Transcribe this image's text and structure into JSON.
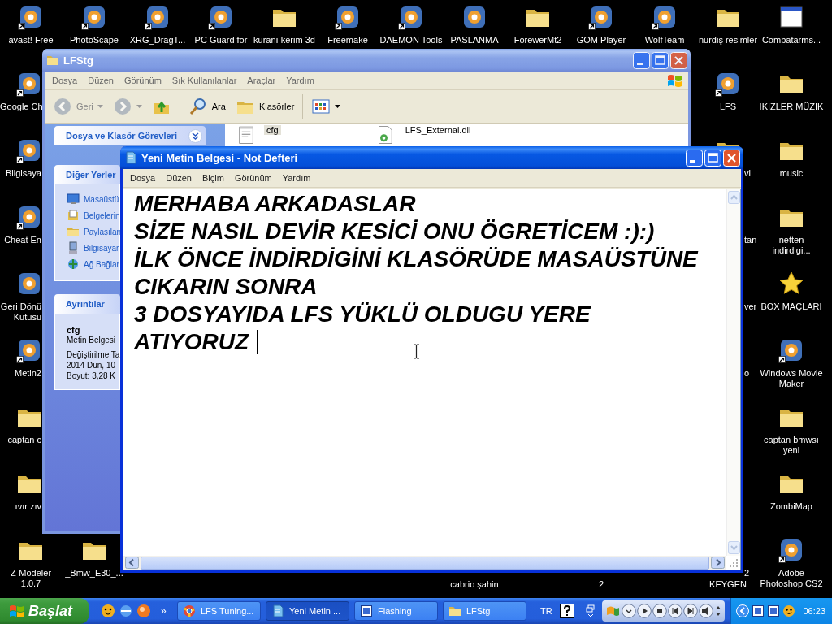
{
  "desktop_icons": [
    {
      "label": [
        "avast! Free"
      ],
      "kind": "app",
      "shortcut": true
    },
    {
      "label": [
        "PhotoScape"
      ],
      "kind": "app",
      "shortcut": true
    },
    {
      "label": [
        "XRG_DragT..."
      ],
      "kind": "app",
      "shortcut": true
    },
    {
      "label": [
        "PC Guard for"
      ],
      "kind": "app",
      "shortcut": true
    },
    {
      "label": [
        "kuranı kerim 3d"
      ],
      "kind": "folder",
      "shortcut": false
    },
    {
      "label": [
        "Freemake"
      ],
      "kind": "app",
      "shortcut": true
    },
    {
      "label": [
        "DAEMON Tools"
      ],
      "kind": "app",
      "shortcut": true
    },
    {
      "label": [
        "PASLANMA"
      ],
      "kind": "app",
      "shortcut": false
    },
    {
      "label": [
        "ForewerMt2"
      ],
      "kind": "folder",
      "shortcut": false
    },
    {
      "label": [
        "GOM Player"
      ],
      "kind": "app",
      "shortcut": true
    },
    {
      "label": [
        "WolfTeam"
      ],
      "kind": "app",
      "shortcut": true
    },
    {
      "label": [
        "nurdiş resimler"
      ],
      "kind": "folder",
      "shortcut": false
    },
    {
      "label": [
        "Combatarms..."
      ],
      "kind": "window",
      "shortcut": false
    },
    {
      "label": [
        "Google Ch"
      ],
      "kind": "app",
      "shortcut": true
    },
    {
      "label": [
        "LFS"
      ],
      "kind": "app",
      "shortcut": true
    },
    {
      "label": [
        "İKİZLER MÜZİK"
      ],
      "kind": "folder",
      "shortcut": false
    },
    {
      "label": [
        "Bilgisaya"
      ],
      "kind": "app",
      "shortcut": true
    },
    {
      "label": [
        "vi"
      ],
      "kind": "folder",
      "shortcut": false
    },
    {
      "label": [
        "music"
      ],
      "kind": "folder",
      "shortcut": false
    },
    {
      "label": [
        "Cheat En"
      ],
      "kind": "app",
      "shortcut": true
    },
    {
      "label": [
        "tan"
      ]
    },
    {
      "label": [
        "netten",
        "indirdigi..."
      ],
      "kind": "folder",
      "shortcut": false
    },
    {
      "label": [
        "Geri Dönü",
        "Kutusu"
      ],
      "kind": "app",
      "shortcut": false
    },
    {
      "label": [
        "ver"
      ]
    },
    {
      "label": [
        "BOX MAÇLARI"
      ],
      "kind": "star",
      "shortcut": false
    },
    {
      "label": [
        "Metin2"
      ],
      "kind": "app",
      "shortcut": true
    },
    {
      "label": [
        "o"
      ]
    },
    {
      "label": [
        "Windows Movie",
        "Maker"
      ],
      "kind": "app",
      "shortcut": true
    },
    {
      "label": [
        "captan c"
      ],
      "kind": "folder",
      "shortcut": false
    },
    {
      "label": [
        "captan bmwsı",
        "yeni"
      ],
      "kind": "folder",
      "shortcut": false
    },
    {
      "label": [
        "ıvır zıv"
      ],
      "kind": "folder",
      "shortcut": false
    },
    {
      "label": [
        "ZombiMap"
      ],
      "kind": "folder",
      "shortcut": false
    },
    {
      "label": [
        "Z-Modeler",
        "1.0.7"
      ],
      "kind": "folder",
      "shortcut": false
    },
    {
      "label": [
        "_Bmw_E30_..."
      ],
      "kind": "folder",
      "shortcut": false
    },
    {
      "label": [
        "cabrio şahin"
      ]
    },
    {
      "label": [
        "2"
      ]
    },
    {
      "label": [
        "2"
      ]
    },
    {
      "label": [
        "KEYGEN"
      ]
    },
    {
      "label": [
        "Adobe",
        "Photoshop CS2"
      ],
      "kind": "app",
      "shortcut": true
    }
  ],
  "explorer_window": {
    "title": "LFStg",
    "active": false,
    "menu": [
      "Dosya",
      "Düzen",
      "Görünüm",
      "Sık Kullanılanlar",
      "Araçlar",
      "Yardım"
    ],
    "toolbar": [
      {
        "kind": "back",
        "label": "Geri",
        "disabled": true
      },
      {
        "kind": "forward",
        "disabled": true
      },
      {
        "kind": "up",
        "disabled": false
      },
      {
        "kind": "search",
        "label": "Ara",
        "disabled": false
      },
      {
        "kind": "folders",
        "label": "Klasörler",
        "disabled": false
      },
      {
        "kind": "views",
        "disabled": false
      }
    ],
    "task_panels": [
      {
        "title": "Dosya ve Klasör Görevleri",
        "expanded": false
      },
      {
        "title": "Diğer Yerler",
        "expanded": true,
        "links": [
          {
            "label": "Masaüstü",
            "kind": "desktop"
          },
          {
            "label": "Belgelerin",
            "kind": "documents"
          },
          {
            "label": "Paylaşılan",
            "kind": "folder"
          },
          {
            "label": "Bilgisayar",
            "kind": "computer"
          },
          {
            "label": "Ağ Bağlar",
            "kind": "network"
          }
        ]
      },
      {
        "title": "Ayrıntılar",
        "expanded": true,
        "name": "cfg",
        "lines": [
          "Metin Belgesi",
          "Değiştirilme Ta",
          "2014 Dün, 10",
          "Boyut: 3,28 K"
        ]
      }
    ],
    "files": [
      {
        "name": "cfg",
        "kind": "text",
        "selected": true
      },
      {
        "name": "LFS_External.dll",
        "kind": "dll",
        "selected": false
      }
    ]
  },
  "notepad_window": {
    "title": "Yeni Metin Belgesi - Not Defteri",
    "active": true,
    "menu": [
      "Dosya",
      "Düzen",
      "Biçim",
      "Görünüm",
      "Yardım"
    ],
    "lines": [
      "MERHABA ARKADASLAR",
      "SİZE NASIL DEVİR KESİCİ ONU ÖGRETİCEM :):)",
      "İLK ÖNCE İNDİRDİGİNİ KLASÖRÜDE MASAÜSTÜNE",
      "CIKARIN SONRA",
      "3 DOSYAYIDA LFS YÜKLÜ OLDUGU YERE",
      "ATIYORUZ"
    ]
  },
  "taskbar": {
    "start": "Başlat",
    "quick_launch_more": "»",
    "buttons": [
      {
        "label": "LFS Tuning...",
        "kind": "browser",
        "selected": false
      },
      {
        "label": "Yeni Metin ...",
        "kind": "notepad",
        "selected": true
      },
      {
        "label": "Flashing",
        "kind": "app",
        "selected": false
      },
      {
        "label": "LFStg",
        "kind": "folder",
        "selected": false
      }
    ],
    "language": "TR",
    "clock": "06:23"
  }
}
